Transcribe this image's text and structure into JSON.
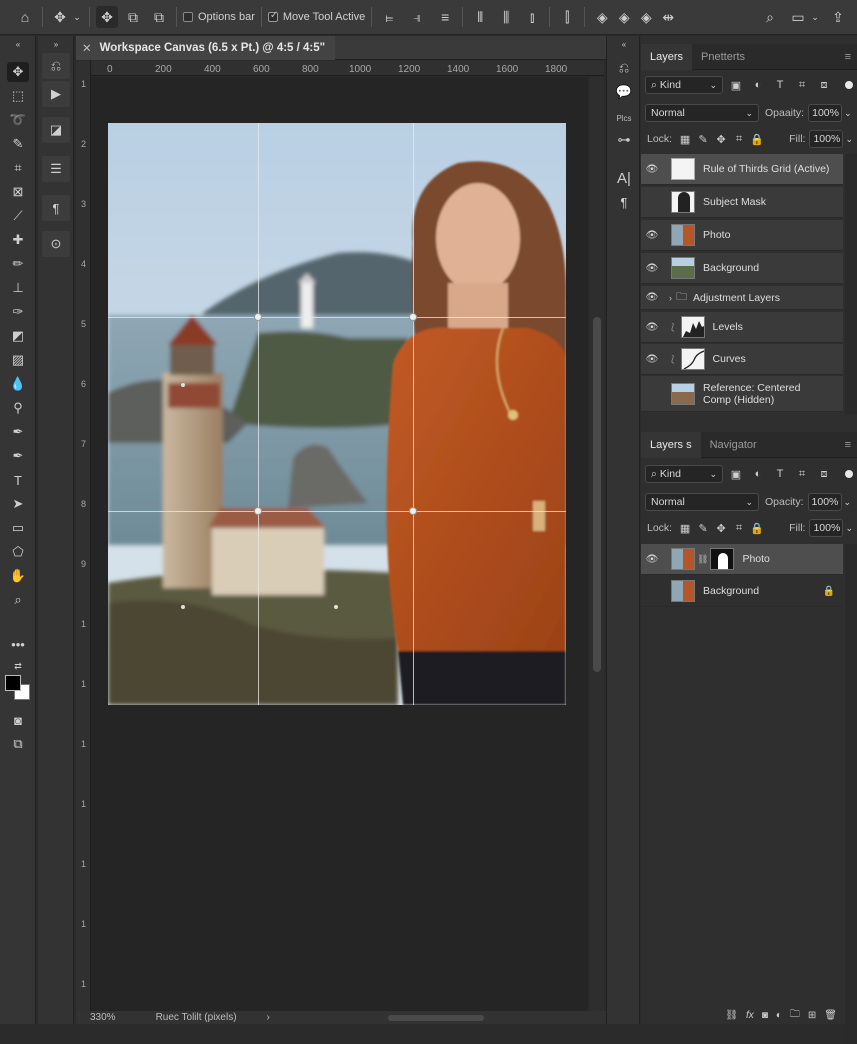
{
  "options_bar": {
    "options_bar_label": "Options bar",
    "move_tool_active_label": "Move Tool Active"
  },
  "document": {
    "tab_title": "Workspace Canvas (6.5 x Pt.) @ 4:5 / 4:5\"",
    "zoom": "330%",
    "status_info": "Ruec Tolilt (pixels)",
    "ruler_h": [
      "0",
      "200",
      "400",
      "600",
      "800",
      "1000",
      "1200",
      "1400",
      "1600",
      "1800"
    ],
    "ruler_v": [
      "1",
      "2",
      "3",
      "4",
      "5",
      "6",
      "7",
      "8",
      "9",
      "1",
      "1",
      "1",
      "1",
      "1",
      "1",
      "1",
      "1"
    ]
  },
  "mid_strip": {
    "plcs_label": "Plcs"
  },
  "layers_panel": {
    "tabs": [
      "Layers",
      "Pnetterts"
    ],
    "kind_label": "Kind",
    "blend_mode": "Normal",
    "opacity_label": "Opaaity:",
    "opacity_value": "100%",
    "lock_label": "Lock:",
    "fill_label": "Fill:",
    "fill_value": "100%",
    "layers": [
      {
        "name": "Rule of Thirds Grid (Active)",
        "visible": true,
        "selected": true
      },
      {
        "name": "Subject Mask",
        "visible": false
      },
      {
        "name": "Photo",
        "visible": true
      },
      {
        "name": "Background",
        "visible": true
      },
      {
        "name": "Adjustment Layers",
        "visible": true,
        "group": true
      },
      {
        "name": "Levels",
        "visible": true
      },
      {
        "name": "Curves",
        "visible": true
      },
      {
        "name": "Reference: Centered Comp (Hidden)",
        "visible": false
      }
    ]
  },
  "layers_panel_2": {
    "tabs": [
      "Layers s",
      "Navigator"
    ],
    "kind_label": "Kind",
    "blend_mode": "Normal",
    "opacity_label": "Opacity:",
    "opacity_value": "100%",
    "lock_label": "Lock:",
    "fill_label": "Fill:",
    "fill_value": "100%",
    "layers": [
      {
        "name": "Photo",
        "visible": true,
        "selected": true
      },
      {
        "name": "Background",
        "visible": false,
        "locked": true
      }
    ]
  },
  "colors": {
    "accent": "#c35a22",
    "panel_bg": "#2f2f2f",
    "selected_row": "#4e4e4e"
  }
}
